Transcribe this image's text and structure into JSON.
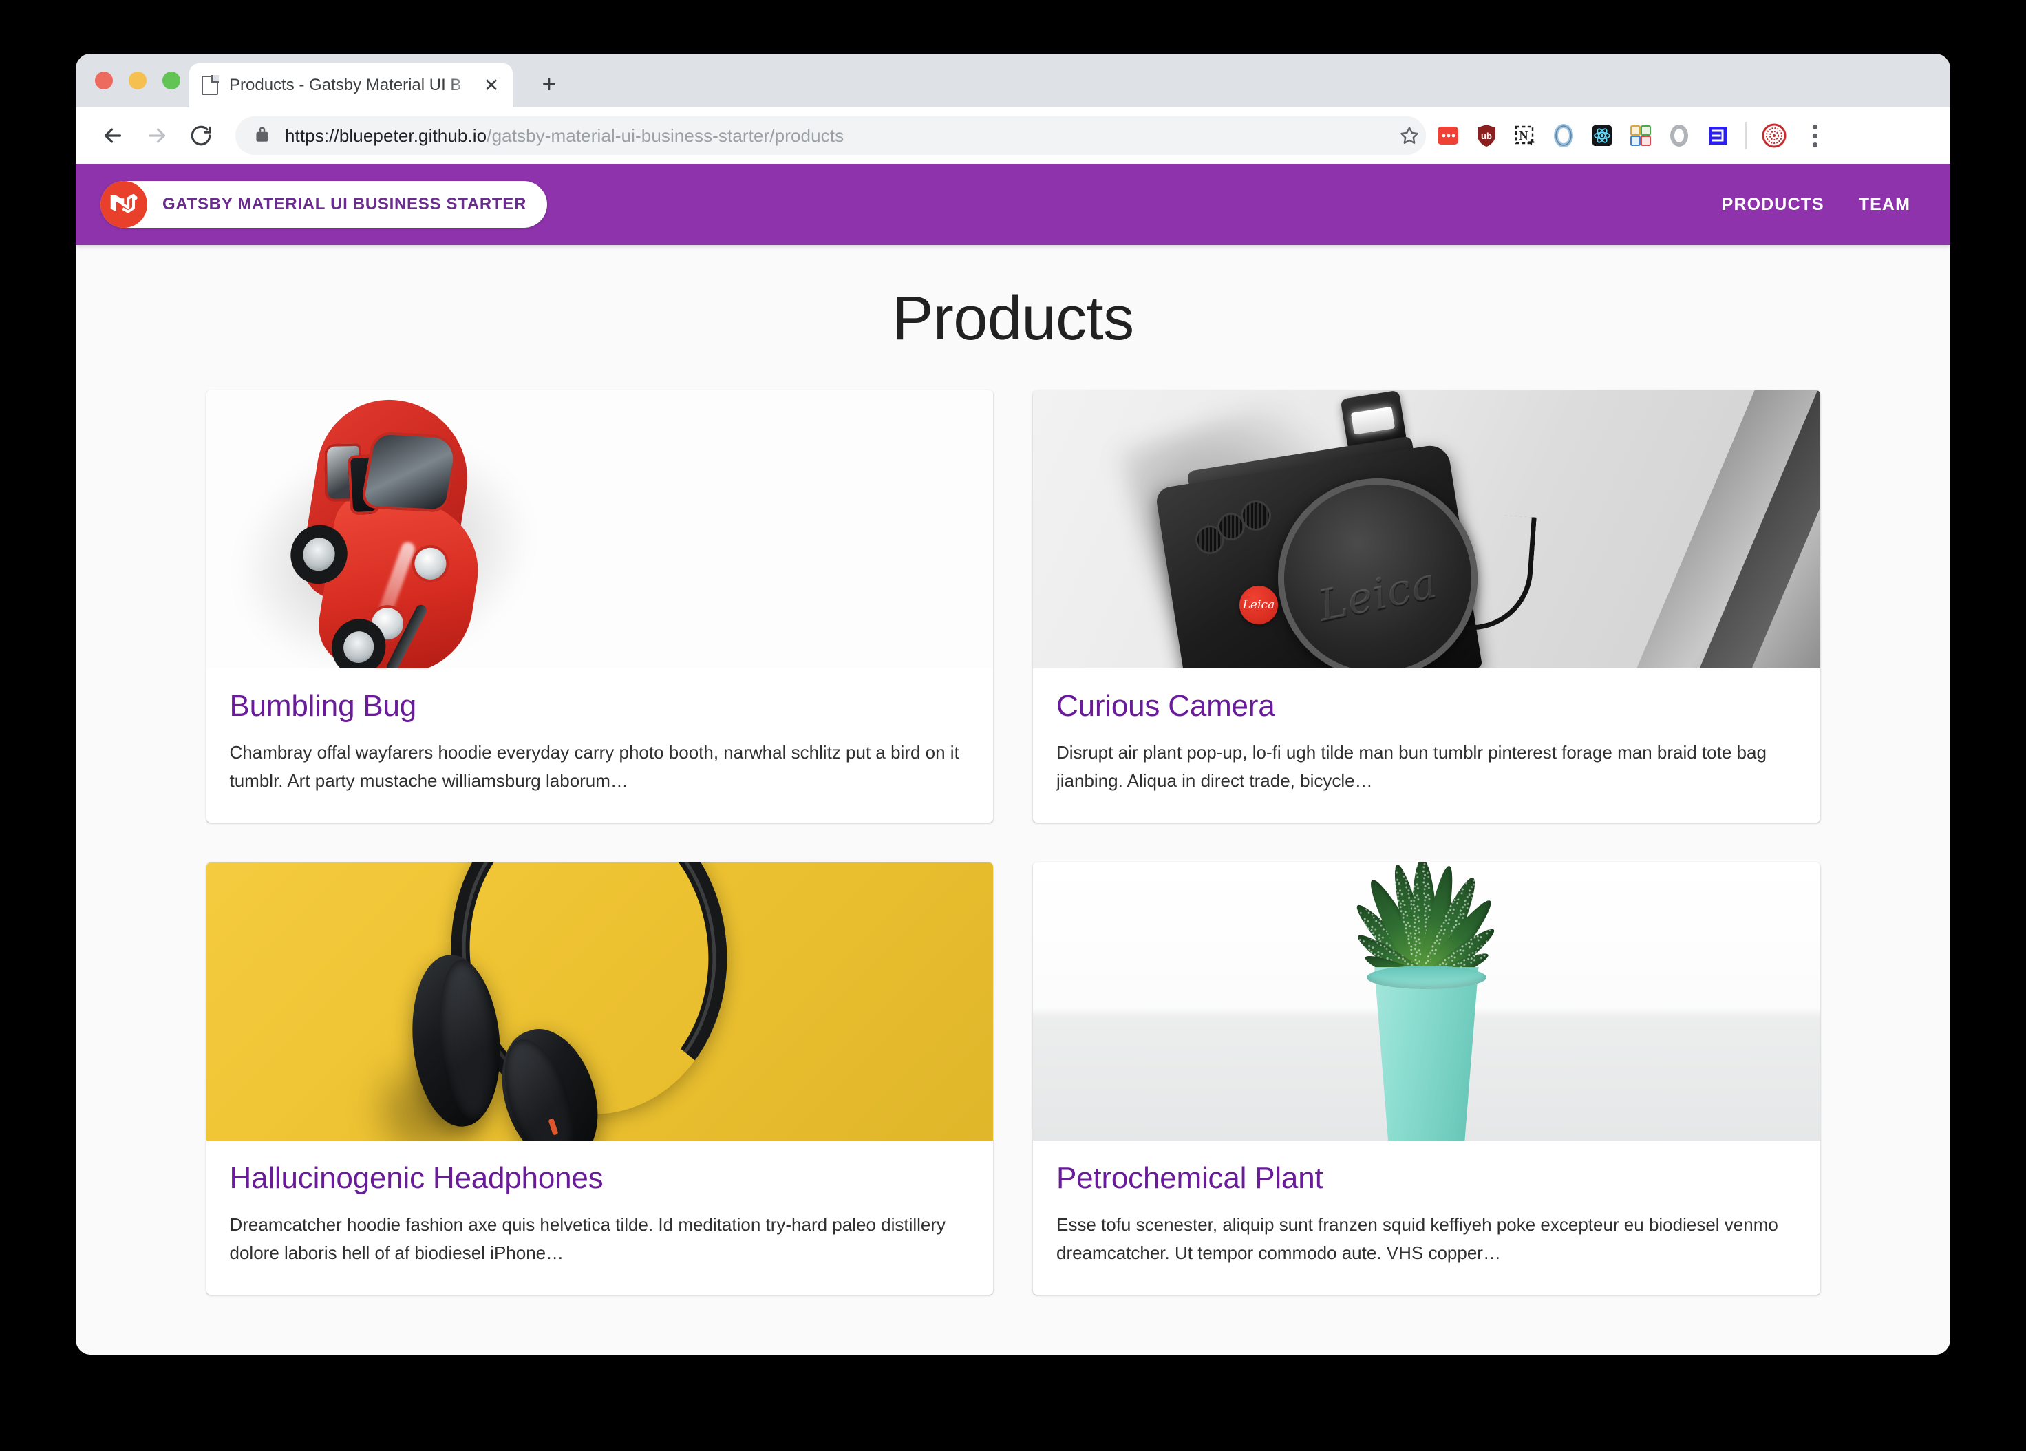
{
  "browser": {
    "tab": {
      "title": "Products - Gatsby Material UI B",
      "favicon_icon": "page-icon",
      "close_icon": "✕"
    },
    "new_tab_icon": "+",
    "nav": {
      "back_icon": "arrow-left-icon",
      "forward_icon": "arrow-right-icon",
      "reload_icon": "reload-icon"
    },
    "omnibox": {
      "lock_icon": "lock-icon",
      "url_scheme_host": "https://bluepeter.github.io",
      "url_path": "/gatsby-material-ui-business-starter/products",
      "star_icon": "star-outline-icon"
    },
    "extensions": [
      {
        "name": "pocket-extension-icon",
        "glyph": "•••|",
        "color": "#ef4136"
      },
      {
        "name": "ublock-origin-icon",
        "glyph": "ub",
        "color": "#8b1f1f"
      },
      {
        "name": "notion-web-clipper-icon",
        "glyph": "N",
        "color": "#1f1f1f"
      },
      {
        "name": "ghostery-icon",
        "glyph": "◎",
        "color": "#8ab4d8"
      },
      {
        "name": "react-devtools-icon",
        "glyph": "⚛",
        "color": "#61dafb"
      },
      {
        "name": "tab-manager-icon",
        "glyph": "▦",
        "color": "#e8a33d"
      },
      {
        "name": "grammarly-icon",
        "glyph": "G",
        "color": "#9aa0a6"
      },
      {
        "name": "metamask-icon",
        "glyph": "M",
        "color": "#2a1fef"
      },
      {
        "name": "profile-avatar-icon",
        "glyph": "⊛",
        "color": "#c72b2b"
      }
    ],
    "menu_icon": "kebab-menu-icon"
  },
  "site": {
    "appbar": {
      "logo_icon": "mui-logo-icon",
      "brand": "GATSBY MATERIAL UI BUSINESS STARTER",
      "nav": [
        {
          "label": "PRODUCTS"
        },
        {
          "label": "TEAM"
        }
      ]
    },
    "page_title": "Products",
    "products": [
      {
        "image": "red-toy-beetle-car-photo",
        "title": "Bumbling Bug",
        "description": "Chambray offal wayfarers hoodie everyday carry photo booth, narwhal schlitz put a bird on it tumblr. Art party mustache williamsburg laborum…"
      },
      {
        "image": "black-leica-camera-photo",
        "title": "Curious Camera",
        "description": "Disrupt air plant pop-up, lo-fi ugh tilde man bun tumblr pinterest forage man braid tote bag jianbing. Aliqua in direct trade, bicycle…"
      },
      {
        "image": "black-headphones-on-yellow-photo",
        "title": "Hallucinogenic Headphones",
        "description": "Dreamcatcher hoodie fashion axe quis helvetica tilde. Id meditation try-hard paleo distillery dolore laboris hell of af biodiesel iPhone…"
      },
      {
        "image": "succulent-plant-in-mint-pot-photo",
        "title": "Petrochemical Plant",
        "description": "Esse tofu scenester, aliquip sunt franzen squid keffiyeh poke excepteur eu biodiesel venmo dreamcatcher. Ut tempor commodo aute. VHS copper…"
      }
    ],
    "colors": {
      "appbar_purple": "#8e33ab",
      "heading_purple": "#6a1b9a",
      "logo_red": "#e8402a",
      "page_background": "#fafafa"
    },
    "camera_lenscap_brand": "Leica",
    "camera_dot_brand": "Leica"
  }
}
